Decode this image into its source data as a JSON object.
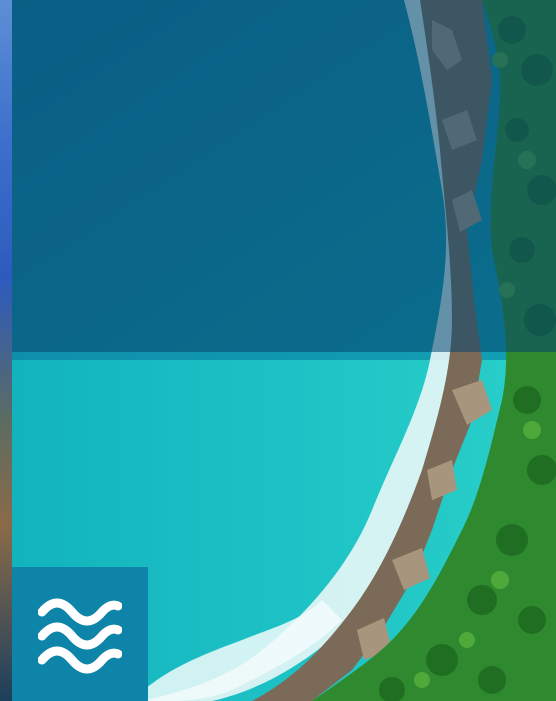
{
  "scene": {
    "subject": "aerial-coastline",
    "colors": {
      "deep_water": "#0d5f85",
      "shallow_water": "#18bdc4",
      "foam": "#e9f7f7",
      "rock": "#7c6a58",
      "forest": "#2f8a2f",
      "tint_overlay": "#08466e",
      "badge": "#0e84a8",
      "badge_icon": "#ffffff"
    }
  },
  "badge": {
    "icon": "waves-icon"
  }
}
